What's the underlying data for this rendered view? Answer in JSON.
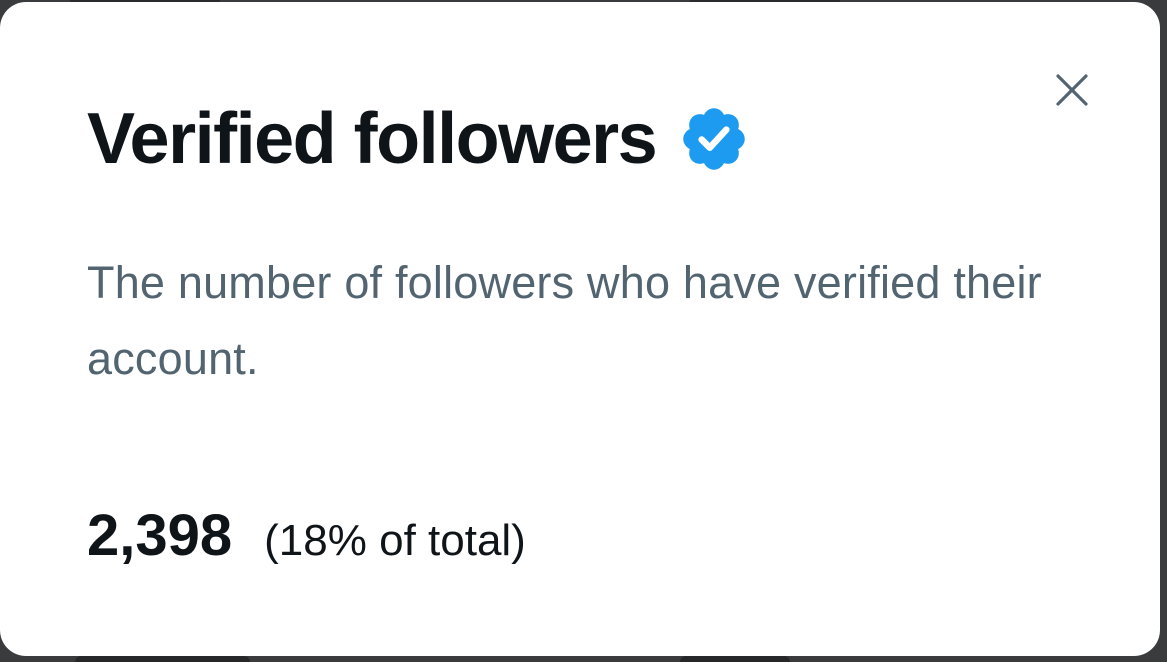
{
  "dialog": {
    "title": "Verified followers",
    "badge_icon": "verified-badge-icon",
    "close_icon": "close-icon",
    "description": "The number of followers who have verified their account.",
    "stat_value": "2,398",
    "stat_share": "(18% of total)"
  },
  "colors": {
    "title_text": "#0f1419",
    "description_text": "#536471",
    "badge_blue": "#1d9bf0",
    "close_icon": "#536471",
    "modal_background": "#ffffff"
  }
}
